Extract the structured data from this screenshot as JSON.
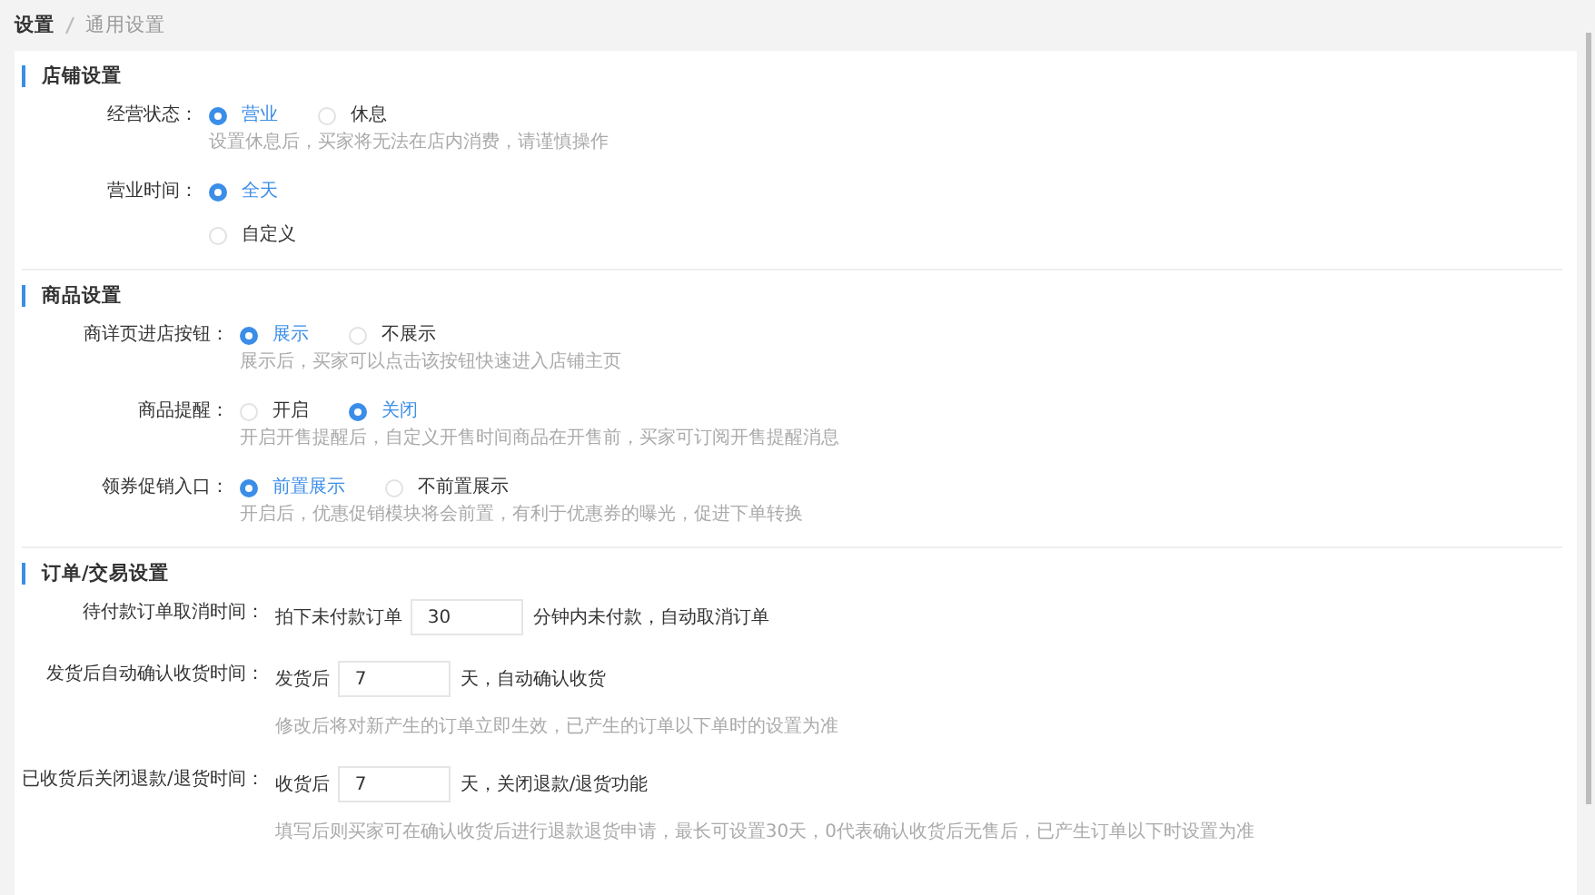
{
  "breadcrumb": [
    {
      "label": "设置",
      "current": false
    },
    {
      "label": "通用设置",
      "current": true
    }
  ],
  "sections": [
    {
      "title": "店铺设置",
      "fields": [
        {
          "kind": "radio",
          "label": "经营状态：",
          "options": [
            {
              "label": "营业",
              "selected": true
            },
            {
              "label": "休息",
              "selected": false
            }
          ],
          "hint": "设置休息后，买家将无法在店内消费，请谨慎操作"
        },
        {
          "kind": "radio-stack",
          "label": "营业时间：",
          "options": [
            {
              "label": "全天",
              "selected": true
            },
            {
              "label": "自定义",
              "selected": false
            }
          ]
        }
      ]
    },
    {
      "title": "商品设置",
      "fields": [
        {
          "kind": "radio",
          "label": "商详页进店按钮：",
          "options": [
            {
              "label": "展示",
              "selected": true
            },
            {
              "label": "不展示",
              "selected": false
            }
          ],
          "hint": "展示后，买家可以点击该按钮快速进入店铺主页"
        },
        {
          "kind": "radio",
          "label": "商品提醒：",
          "options": [
            {
              "label": "开启",
              "selected": false
            },
            {
              "label": "关闭",
              "selected": true
            }
          ],
          "hint": "开启开售提醒后，自定义开售时间商品在开售前，买家可订阅开售提醒消息"
        },
        {
          "kind": "radio",
          "label": "领券促销入口：",
          "options": [
            {
              "label": "前置展示",
              "selected": true
            },
            {
              "label": "不前置展示",
              "selected": false
            }
          ],
          "hint": "开启后，优惠促销模块将会前置，有利于优惠券的曝光，促进下单转换"
        }
      ]
    },
    {
      "title": "订单/交易设置",
      "fields": [
        {
          "kind": "input",
          "label": "待付款订单取消时间：",
          "prefix": "拍下未付款订单",
          "value": "30",
          "suffix": "分钟内未付款，自动取消订单"
        },
        {
          "kind": "input",
          "label": "发货后自动确认收货时间：",
          "prefix": "发货后",
          "value": "7",
          "suffix": "天，自动确认收货",
          "hint": "修改后将对新产生的订单立即生效，已产生的订单以下单时的设置为准"
        },
        {
          "kind": "input",
          "label": "已收货后关闭退款/退货时间：",
          "prefix": "收货后",
          "value": "7",
          "suffix": "天，关闭退款/退货功能",
          "hint": "填写后则买家可在确认收货后进行退款退货申请，最长可设置30天，0代表确认收货后无售后，已产生订单以下时设置为准"
        }
      ]
    }
  ]
}
